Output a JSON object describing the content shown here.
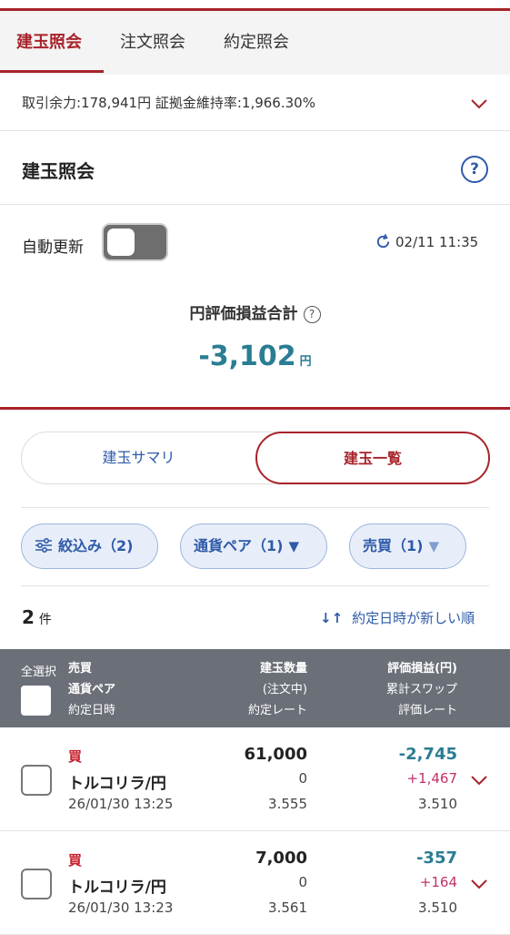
{
  "tabs": [
    {
      "label": "建玉照会",
      "active": true
    },
    {
      "label": "注文照会",
      "active": false
    },
    {
      "label": "約定照会",
      "active": false
    }
  ],
  "margin_info": "取引余力:178,941円 証拠金維持率:1,966.30%",
  "section_title": "建玉照会",
  "help_icon_text": "?",
  "auto_update": {
    "label": "自動更新",
    "on": false
  },
  "updated_at": "02/11 11:35",
  "pl_total": {
    "label": "円評価損益合計",
    "value": "-3,102",
    "unit": "円"
  },
  "segment": {
    "left": "建玉サマリ",
    "right": "建玉一覧",
    "selected": "right"
  },
  "filters": [
    {
      "label": "絞込み（2)",
      "icon": "filter-sliders-icon"
    },
    {
      "label": "通貨ペア（1)",
      "icon": "triangle-down-icon"
    },
    {
      "label": "売買（1)",
      "icon": "triangle-down-icon"
    }
  ],
  "count": {
    "value": "2",
    "unit": "件"
  },
  "sort_label": "約定日時が新しい順",
  "header": {
    "select_all": "全選択",
    "col1": [
      "売買",
      "通貨ペア",
      "約定日時"
    ],
    "col2": [
      "建玉数量",
      "(注文中)",
      "約定レート"
    ],
    "col3": [
      "評価損益(円)",
      "累計スワップ",
      "評価レート"
    ]
  },
  "rows": [
    {
      "side": "買",
      "pair": "トルコリラ/円",
      "date": "26/01/30 13:25",
      "qty": "61,000",
      "ordering": "0",
      "rate": "3.555",
      "pl": "-2,745",
      "swap": "+1,467",
      "eval_rate": "3.510"
    },
    {
      "side": "買",
      "pair": "トルコリラ/円",
      "date": "26/01/30 13:23",
      "qty": "7,000",
      "ordering": "0",
      "rate": "3.561",
      "pl": "-357",
      "swap": "+164",
      "eval_rate": "3.510"
    }
  ],
  "colors": {
    "accent_red": "#a8232b",
    "link_blue": "#2e5aa8",
    "pl_teal": "#2a7d92",
    "swap_pink": "#c2306b",
    "header_gray": "#6b6f78"
  }
}
